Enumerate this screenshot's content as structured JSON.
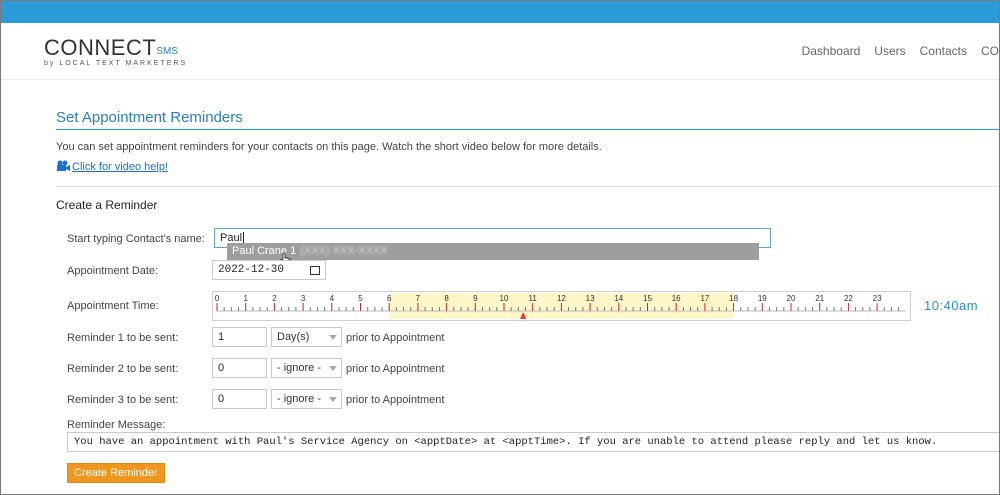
{
  "brand": {
    "name": "CONNECT",
    "suffix": "SMS",
    "tagline": "by LOCAL TEXT MARKETERS"
  },
  "nav": {
    "items": [
      "Dashboard",
      "Users",
      "Contacts",
      "CO"
    ]
  },
  "page": {
    "title": "Set Appointment Reminders",
    "intro": "You can set appointment reminders for your contacts on this page. Watch the short video below for more details.",
    "video_link": "Click for video help!",
    "section_title": "Create a Reminder"
  },
  "form": {
    "contact_label": "Start typing Contact's name:",
    "contact_value": "Paul",
    "suggestion_name": "Paul Crane 1",
    "suggestion_phone": "(XXX) XXX-XXXX",
    "date_label": "Appointment Date:",
    "date_value": "2022-12-30",
    "time_label": "Appointment Time:",
    "time_readout": "10:40am",
    "timeline": {
      "hours": [
        "0",
        "1",
        "2",
        "3",
        "4",
        "5",
        "6",
        "7",
        "8",
        "9",
        "10",
        "11",
        "12",
        "13",
        "14",
        "15",
        "16",
        "17",
        "18",
        "19",
        "20",
        "21",
        "22",
        "23"
      ],
      "selected_hour": 10.667,
      "highlight_start_hour": 6,
      "highlight_end_hour": 18,
      "highlight_color": "#fdf6c8",
      "marker_color": "#e53935"
    },
    "reminders": [
      {
        "label": "Reminder 1 to be sent:",
        "value": "1",
        "unit": "Day(s)",
        "suffix": "prior to Appointment"
      },
      {
        "label": "Reminder 2 to be sent:",
        "value": "0",
        "unit": "- ignore -",
        "suffix": "prior to Appointment"
      },
      {
        "label": "Reminder 3 to be sent:",
        "value": "0",
        "unit": "- ignore -",
        "suffix": "prior to Appointment"
      }
    ],
    "message_label": "Reminder Message:",
    "message_value": "You have an appointment with Paul's Service Agency on <apptDate> at <apptTime>. If you are unable to attend please reply and let us know.",
    "submit_label": "Create Reminder"
  },
  "colors": {
    "topbar": "#2a9bd8",
    "accent": "#2a7fc0",
    "button": "#f0961e"
  }
}
